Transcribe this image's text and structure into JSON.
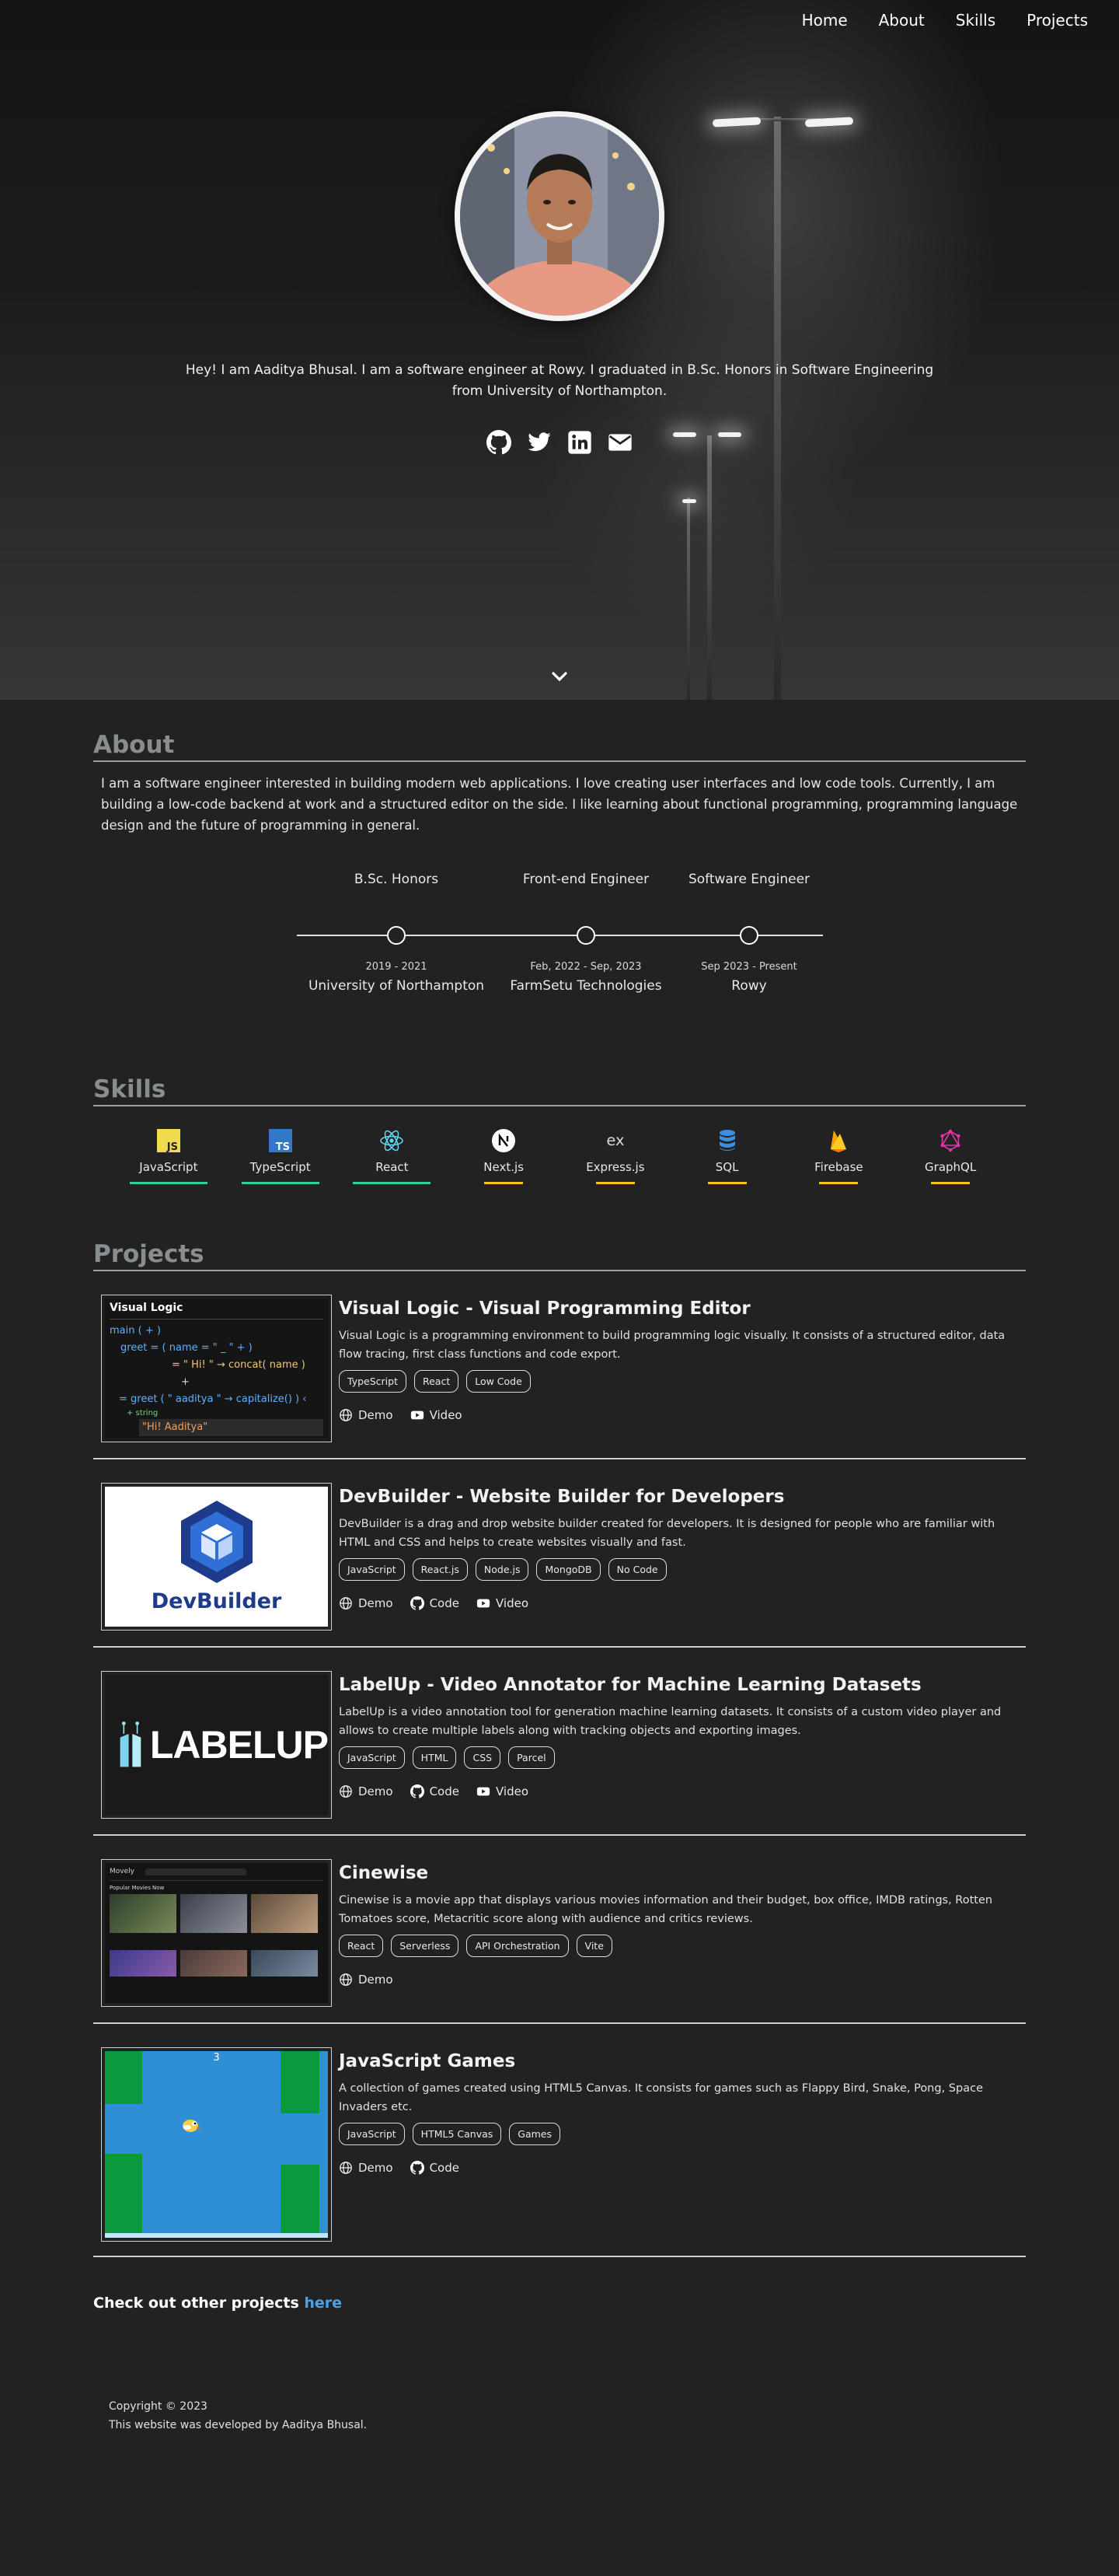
{
  "nav": [
    "Home",
    "About",
    "Skills",
    "Projects"
  ],
  "hero": {
    "intro": "Hey! I am Aaditya Bhusal. I am a software engineer at Rowy. I graduated in B.Sc. Honors in Software Engineering from University of Northampton.",
    "socials": [
      "github-icon",
      "twitter-icon",
      "linkedin-icon",
      "mail-icon"
    ]
  },
  "about": {
    "title": "About",
    "text": "I am a software engineer interested in building modern web applications. I love creating user interfaces and low code tools. Currently, I am building a low-code backend at work and a structured editor on the side. I like learning about functional programming, programming language design and the future of programming in general.",
    "timeline": [
      {
        "role": "B.Sc. Honors",
        "date": "2019 - 2021",
        "place": "University of Northampton"
      },
      {
        "role": "Front-end Engineer",
        "date": "Feb, 2022 - Sep, 2023",
        "place": "FarmSetu Technologies"
      },
      {
        "role": "Software Engineer",
        "date": "Sep 2023 - Present",
        "place": "Rowy"
      }
    ]
  },
  "skills": {
    "title": "Skills",
    "items": [
      {
        "name": "JavaScript",
        "level": 1.0,
        "color": "#2fd39a"
      },
      {
        "name": "TypeScript",
        "level": 1.0,
        "color": "#2fd39a"
      },
      {
        "name": "React",
        "level": 1.0,
        "color": "#2fd39a"
      },
      {
        "name": "Next.js",
        "level": 0.5,
        "color": "#f5c518"
      },
      {
        "name": "Express.js",
        "level": 0.5,
        "color": "#f5c518"
      },
      {
        "name": "SQL",
        "level": 0.5,
        "color": "#f5c518"
      },
      {
        "name": "Firebase",
        "level": 0.5,
        "color": "#f5c518"
      },
      {
        "name": "GraphQL",
        "level": 0.5,
        "color": "#f5c518"
      }
    ]
  },
  "projects": {
    "title": "Projects",
    "items": [
      {
        "title": "Visual Logic - Visual Programming Editor",
        "desc": "Visual Logic is a programming environment to build programming logic visually. It consists of a structured editor, data flow tracing, first class functions and code export.",
        "tags": [
          "TypeScript",
          "React",
          "Low Code"
        ],
        "links": [
          "Demo",
          "Video"
        ],
        "thumb": {
          "heading": "Visual Logic",
          "lines": [
            "main ( + )",
            "greet = ( name = \" _ \" + )",
            "= \" Hi! \" → concat( name )",
            "+",
            "= greet ( \" aaditya \" → capitalize() ) ‹",
            "+ string",
            "\"Hi! Aaditya\""
          ]
        }
      },
      {
        "title": "DevBuilder - Website Builder for Developers",
        "desc": "DevBuilder is a drag and drop website builder created for developers. It is designed for people who are familiar with HTML and CSS and helps to create websites visually and fast.",
        "tags": [
          "JavaScript",
          "React.js",
          "Node.js",
          "MongoDB",
          "No Code"
        ],
        "links": [
          "Demo",
          "Code",
          "Video"
        ],
        "thumb": {
          "logo": "DevBuilder"
        }
      },
      {
        "title": "LabelUp - Video Annotator for Machine Learning Datasets",
        "desc": "LabelUp is a video annotation tool for generation machine learning datasets. It consists of a custom video player and allows to create multiple labels along with tracking objects and exporting images.",
        "tags": [
          "JavaScript",
          "HTML",
          "CSS",
          "Parcel"
        ],
        "links": [
          "Demo",
          "Code",
          "Video"
        ],
        "thumb": {
          "logo": "LABELUP"
        }
      },
      {
        "title": "Cinewise",
        "desc": "Cinewise is a movie app that displays various movies information and their budget, box office, IMDB ratings, Rotten Tomatoes score, Metacritic score along with audience and critics reviews.",
        "tags": [
          "React",
          "Serverless",
          "API Orchestration",
          "Vite"
        ],
        "links": [
          "Demo"
        ],
        "thumb": {
          "app": "Movely",
          "row_title": "Popular Movies Now"
        }
      },
      {
        "title": "JavaScript Games",
        "desc": "A collection of games created using HTML5 Canvas. It consists for games such as Flappy Bird, Snake, Pong, Space Invaders etc.",
        "tags": [
          "JavaScript",
          "HTML5 Canvas",
          "Games"
        ],
        "links": [
          "Demo",
          "Code"
        ],
        "thumb": {
          "score": "3"
        }
      }
    ]
  },
  "more": {
    "text": "Check out other projects ",
    "link": "here"
  },
  "footer": {
    "copyright": "Copyright © 2023",
    "credit": "This website was developed by Aaditya Bhusal."
  }
}
